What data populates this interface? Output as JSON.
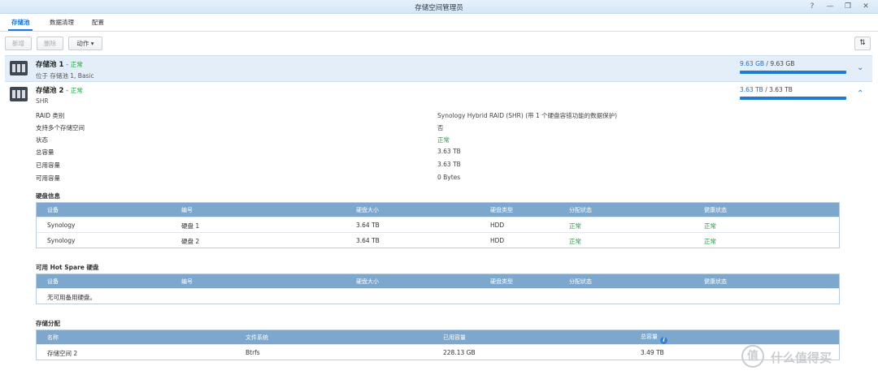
{
  "window": {
    "title": "存储空间管理员",
    "help_glyph": "?",
    "minimize_glyph": "—",
    "maximize_glyph": "❐",
    "close_glyph": "✕"
  },
  "tabs": [
    {
      "label": "存储池",
      "active": true
    },
    {
      "label": "数据清理",
      "active": false
    },
    {
      "label": "配置",
      "active": false
    }
  ],
  "toolbar": {
    "create_label": "新增",
    "delete_label": "删除",
    "action_label": "动作 ▾",
    "sort_glyph": "⇅"
  },
  "pools": [
    {
      "name": "存储池 1",
      "separator": " - ",
      "status": "正常",
      "subtitle": "位于 存储池 1, Basic",
      "used": "9.63 GB",
      "slash": " / ",
      "total": "9.63 GB",
      "fill_fraction": 1.0,
      "expanded": false,
      "chevron": "⌄"
    },
    {
      "name": "存储池 2",
      "separator": " - ",
      "status": "正常",
      "subtitle": "SHR",
      "used": "3.63 TB",
      "slash": " / ",
      "total": "3.63 TB",
      "fill_fraction": 1.0,
      "expanded": true,
      "chevron": "⌃"
    }
  ],
  "details": [
    {
      "label": "RAID 类别",
      "value": "Synology Hybrid RAID (SHR) (带 1 个硬盘容错功能的数据保护)",
      "ok": false
    },
    {
      "label": "支持多个存储空间",
      "value": "否",
      "ok": false
    },
    {
      "label": "状态",
      "value": "正常",
      "ok": true
    },
    {
      "label": "总容量",
      "value": "3.63 TB",
      "ok": false
    },
    {
      "label": "已用容量",
      "value": "3.63 TB",
      "ok": false
    },
    {
      "label": "可用容量",
      "value": "0 Bytes",
      "ok": false
    }
  ],
  "disk_info": {
    "title": "硬盘信息",
    "columns": [
      "设备",
      "编号",
      "硬盘大小",
      "硬盘类型",
      "分配状态",
      "健康状态"
    ],
    "rows": [
      [
        "Synology",
        "硬盘 1",
        "3.64 TB",
        "HDD",
        "正常",
        "正常"
      ],
      [
        "Synology",
        "硬盘 2",
        "3.64 TB",
        "HDD",
        "正常",
        "正常"
      ]
    ]
  },
  "hot_spare": {
    "title": "可用 Hot Spare 硬盘",
    "columns": [
      "设备",
      "编号",
      "硬盘大小",
      "硬盘类型",
      "分配状态",
      "健康状态"
    ],
    "empty_text": "无可用备用硬盘。"
  },
  "allocation": {
    "title": "存储分配",
    "columns": [
      "名称",
      "文件系统",
      "已用容量",
      "总容量"
    ],
    "info_glyph": "i",
    "rows": [
      [
        "存储空间 2",
        "Btrfs",
        "228.13 GB",
        "3.49 TB"
      ]
    ]
  },
  "watermark": {
    "logo_glyph": "值",
    "text": "什么值得买"
  },
  "colors": {
    "accent": "#1f7bd1",
    "ok_green": "#1e9e39",
    "grid_header": "#7ea7cd",
    "selected_row": "#e3eef8"
  }
}
